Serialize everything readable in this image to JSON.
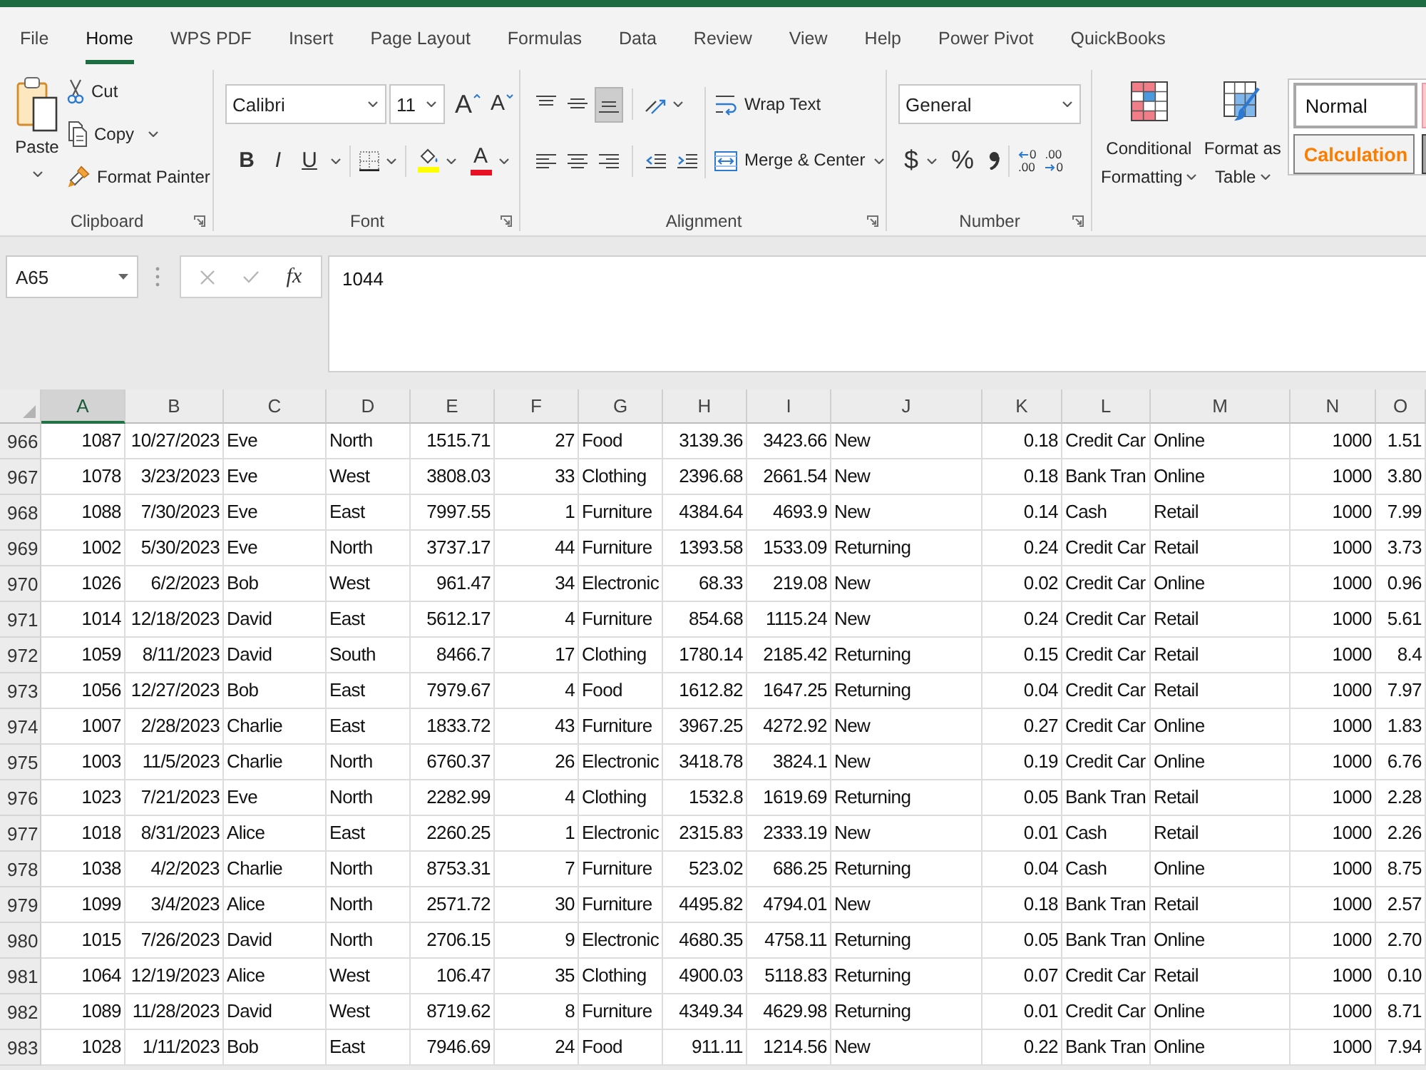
{
  "ribbon_tabs": [
    {
      "label": "File",
      "selected": false
    },
    {
      "label": "Home",
      "selected": true
    },
    {
      "label": "WPS PDF",
      "selected": false
    },
    {
      "label": "Insert",
      "selected": false
    },
    {
      "label": "Page Layout",
      "selected": false
    },
    {
      "label": "Formulas",
      "selected": false
    },
    {
      "label": "Data",
      "selected": false
    },
    {
      "label": "Review",
      "selected": false
    },
    {
      "label": "View",
      "selected": false
    },
    {
      "label": "Help",
      "selected": false
    },
    {
      "label": "Power Pivot",
      "selected": false
    },
    {
      "label": "QuickBooks",
      "selected": false
    }
  ],
  "ribbon": {
    "clipboard": {
      "label": "Clipboard",
      "paste": "Paste",
      "cut": "Cut",
      "copy": "Copy",
      "format_painter": "Format Painter"
    },
    "font": {
      "label": "Font",
      "font_name": "Calibri",
      "font_size": "11",
      "size_buttons": [
        {
          "kind": "grow",
          "glyph": "A"
        },
        {
          "kind": "shrink",
          "glyph": "A"
        }
      ],
      "style_buttons": [
        {
          "kind": "bold",
          "glyph": "B"
        },
        {
          "kind": "italic",
          "glyph": "I"
        },
        {
          "kind": "underline",
          "glyph": "U"
        }
      ],
      "color_buttons": [
        {
          "kind": "fill",
          "color": "#ffff00"
        },
        {
          "kind": "font",
          "glyph": "A",
          "color": "#e81123"
        }
      ]
    },
    "alignment": {
      "label": "Alignment",
      "top_buttons": [
        {
          "kind": "align-top",
          "on": false
        },
        {
          "kind": "align-middle",
          "on": false
        },
        {
          "kind": "align-bottom",
          "on": true
        },
        {
          "kind": "orientation",
          "on": false
        }
      ],
      "bottom_buttons": [
        {
          "kind": "align-left",
          "on": false
        },
        {
          "kind": "align-center",
          "on": false
        },
        {
          "kind": "align-right",
          "on": false
        },
        {
          "kind": "decrease-indent",
          "on": false
        },
        {
          "kind": "increase-indent",
          "on": false
        }
      ],
      "wrap_text": "Wrap Text",
      "merge_center": "Merge & Center"
    },
    "number": {
      "label": "Number",
      "format": "General",
      "symbol_buttons": [
        {
          "kind": "currency",
          "glyph": "$"
        },
        {
          "kind": "percent",
          "glyph": "%"
        }
      ],
      "decimal_buttons": [
        {
          "kind": "increase",
          "lines": [
            "0",
            ".00"
          ]
        },
        {
          "kind": "decrease",
          "lines": [
            ".00",
            "0"
          ]
        }
      ]
    },
    "styles": {
      "conditional_formatting": [
        "Conditional",
        "Formatting"
      ],
      "format_as_table": [
        "Format as",
        "Table"
      ],
      "cell_styles": [
        {
          "kind": "normal",
          "label": "Normal"
        },
        {
          "kind": "calculation",
          "label": "Calculation"
        }
      ]
    }
  },
  "formula_bar": {
    "name_box": "A65",
    "edit_buttons": [
      {
        "kind": "cancel",
        "disabled": true
      },
      {
        "kind": "enter",
        "disabled": true
      }
    ],
    "function_button": "fx",
    "formula": "1044"
  },
  "sheet": {
    "columns": [
      {
        "label": "A",
        "selected": true,
        "kind": "number"
      },
      {
        "label": "B",
        "selected": false,
        "kind": "date"
      },
      {
        "label": "C",
        "selected": false,
        "kind": "text"
      },
      {
        "label": "D",
        "selected": false,
        "kind": "text"
      },
      {
        "label": "E",
        "selected": false,
        "kind": "number"
      },
      {
        "label": "F",
        "selected": false,
        "kind": "number"
      },
      {
        "label": "G",
        "selected": false,
        "kind": "text"
      },
      {
        "label": "H",
        "selected": false,
        "kind": "number"
      },
      {
        "label": "I",
        "selected": false,
        "kind": "number"
      },
      {
        "label": "J",
        "selected": false,
        "kind": "text"
      },
      {
        "label": "K",
        "selected": false,
        "kind": "number"
      },
      {
        "label": "L",
        "selected": false,
        "kind": "text"
      },
      {
        "label": "M",
        "selected": false,
        "kind": "text"
      },
      {
        "label": "N",
        "selected": false,
        "kind": "number"
      },
      {
        "label": "O",
        "selected": false,
        "kind": "number"
      }
    ],
    "rows": [
      {
        "header": "966",
        "cells": [
          "1087",
          "10/27/2023",
          "Eve",
          "North",
          "1515.71",
          "27",
          "Food",
          "3139.36",
          "3423.66",
          "New",
          "0.18",
          "Credit Car",
          "Online",
          "1000",
          "1.51"
        ]
      },
      {
        "header": "967",
        "cells": [
          "1078",
          "3/23/2023",
          "Eve",
          "West",
          "3808.03",
          "33",
          "Clothing",
          "2396.68",
          "2661.54",
          "New",
          "0.18",
          "Bank Tran",
          "Online",
          "1000",
          "3.80"
        ]
      },
      {
        "header": "968",
        "cells": [
          "1088",
          "7/30/2023",
          "Eve",
          "East",
          "7997.55",
          "1",
          "Furniture",
          "4384.64",
          "4693.9",
          "New",
          "0.14",
          "Cash",
          "Retail",
          "1000",
          "7.99"
        ]
      },
      {
        "header": "969",
        "cells": [
          "1002",
          "5/30/2023",
          "Eve",
          "North",
          "3737.17",
          "44",
          "Furniture",
          "1393.58",
          "1533.09",
          "Returning",
          "0.24",
          "Credit Car",
          "Retail",
          "1000",
          "3.73"
        ]
      },
      {
        "header": "970",
        "cells": [
          "1026",
          "6/2/2023",
          "Bob",
          "West",
          "961.47",
          "34",
          "Electronic",
          "68.33",
          "219.08",
          "New",
          "0.02",
          "Credit Car",
          "Online",
          "1000",
          "0.96"
        ]
      },
      {
        "header": "971",
        "cells": [
          "1014",
          "12/18/2023",
          "David",
          "East",
          "5612.17",
          "4",
          "Furniture",
          "854.68",
          "1115.24",
          "New",
          "0.24",
          "Credit Car",
          "Retail",
          "1000",
          "5.61"
        ]
      },
      {
        "header": "972",
        "cells": [
          "1059",
          "8/11/2023",
          "David",
          "South",
          "8466.7",
          "17",
          "Clothing",
          "1780.14",
          "2185.42",
          "Returning",
          "0.15",
          "Credit Car",
          "Retail",
          "1000",
          "8.4"
        ]
      },
      {
        "header": "973",
        "cells": [
          "1056",
          "12/27/2023",
          "Bob",
          "East",
          "7979.67",
          "4",
          "Food",
          "1612.82",
          "1647.25",
          "Returning",
          "0.04",
          "Credit Car",
          "Retail",
          "1000",
          "7.97"
        ]
      },
      {
        "header": "974",
        "cells": [
          "1007",
          "2/28/2023",
          "Charlie",
          "East",
          "1833.72",
          "43",
          "Furniture",
          "3967.25",
          "4272.92",
          "New",
          "0.27",
          "Credit Car",
          "Online",
          "1000",
          "1.83"
        ]
      },
      {
        "header": "975",
        "cells": [
          "1003",
          "11/5/2023",
          "Charlie",
          "North",
          "6760.37",
          "26",
          "Electronic",
          "3418.78",
          "3824.1",
          "New",
          "0.19",
          "Credit Car",
          "Online",
          "1000",
          "6.76"
        ]
      },
      {
        "header": "976",
        "cells": [
          "1023",
          "7/21/2023",
          "Eve",
          "North",
          "2282.99",
          "4",
          "Clothing",
          "1532.8",
          "1619.69",
          "Returning",
          "0.05",
          "Bank Tran",
          "Retail",
          "1000",
          "2.28"
        ]
      },
      {
        "header": "977",
        "cells": [
          "1018",
          "8/31/2023",
          "Alice",
          "East",
          "2260.25",
          "1",
          "Electronic",
          "2315.83",
          "2333.19",
          "New",
          "0.01",
          "Cash",
          "Retail",
          "1000",
          "2.26"
        ]
      },
      {
        "header": "978",
        "cells": [
          "1038",
          "4/2/2023",
          "Charlie",
          "North",
          "8753.31",
          "7",
          "Furniture",
          "523.02",
          "686.25",
          "Returning",
          "0.04",
          "Cash",
          "Online",
          "1000",
          "8.75"
        ]
      },
      {
        "header": "979",
        "cells": [
          "1099",
          "3/4/2023",
          "Alice",
          "North",
          "2571.72",
          "30",
          "Furniture",
          "4495.82",
          "4794.01",
          "New",
          "0.18",
          "Bank Tran",
          "Retail",
          "1000",
          "2.57"
        ]
      },
      {
        "header": "980",
        "cells": [
          "1015",
          "7/26/2023",
          "David",
          "North",
          "2706.15",
          "9",
          "Electronic",
          "4680.35",
          "4758.11",
          "Returning",
          "0.05",
          "Bank Tran",
          "Online",
          "1000",
          "2.70"
        ]
      },
      {
        "header": "981",
        "cells": [
          "1064",
          "12/19/2023",
          "Alice",
          "West",
          "106.47",
          "35",
          "Clothing",
          "4900.03",
          "5118.83",
          "Returning",
          "0.07",
          "Credit Car",
          "Retail",
          "1000",
          "0.10"
        ]
      },
      {
        "header": "982",
        "cells": [
          "1089",
          "11/28/2023",
          "David",
          "West",
          "8719.62",
          "8",
          "Furniture",
          "4349.34",
          "4629.98",
          "Returning",
          "0.01",
          "Credit Car",
          "Online",
          "1000",
          "8.71"
        ]
      },
      {
        "header": "983",
        "cells": [
          "1028",
          "1/11/2023",
          "Bob",
          "East",
          "7946.69",
          "24",
          "Food",
          "911.11",
          "1214.56",
          "New",
          "0.22",
          "Bank Tran",
          "Online",
          "1000",
          "7.94"
        ]
      }
    ]
  }
}
